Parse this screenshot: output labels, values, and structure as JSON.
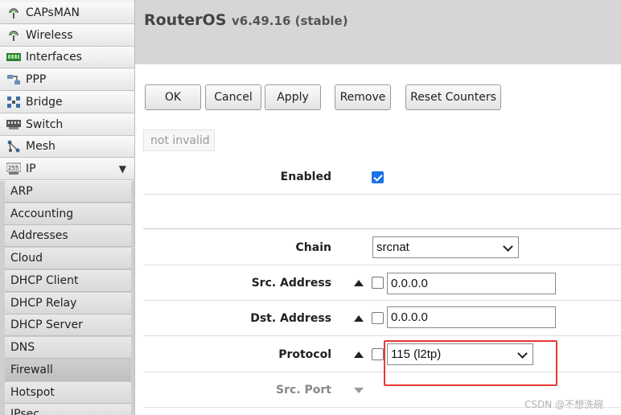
{
  "sidebar": {
    "items": [
      {
        "label": "CAPsMAN",
        "icon": "capsman-antenna-icon"
      },
      {
        "label": "Wireless",
        "icon": "wireless-antenna-icon"
      },
      {
        "label": "Interfaces",
        "icon": "interfaces-icon"
      },
      {
        "label": "PPP",
        "icon": "ppp-icon"
      },
      {
        "label": "Bridge",
        "icon": "bridge-icon"
      },
      {
        "label": "Switch",
        "icon": "switch-icon"
      },
      {
        "label": "Mesh",
        "icon": "mesh-icon"
      },
      {
        "label": "IP",
        "icon": "ip-icon",
        "expand_glyph": "▼"
      }
    ],
    "sub_items": [
      {
        "label": "ARP"
      },
      {
        "label": "Accounting"
      },
      {
        "label": "Addresses"
      },
      {
        "label": "Cloud"
      },
      {
        "label": "DHCP Client"
      },
      {
        "label": "DHCP Relay"
      },
      {
        "label": "DHCP Server"
      },
      {
        "label": "DNS"
      },
      {
        "label": "Firewall",
        "active": true
      },
      {
        "label": "Hotspot"
      },
      {
        "label": "IPsec"
      }
    ]
  },
  "header": {
    "product": "RouterOS",
    "version": "v6.49.16 (stable)"
  },
  "toolbar": {
    "ok": "OK",
    "cancel": "Cancel",
    "apply": "Apply",
    "remove": "Remove",
    "reset_counters": "Reset Counters"
  },
  "status_tag": "not invalid",
  "form": {
    "enabled": {
      "label": "Enabled",
      "checked": true
    },
    "chain": {
      "label": "Chain",
      "value": "srcnat"
    },
    "src_address": {
      "label": "Src. Address",
      "value": "0.0.0.0"
    },
    "dst_address": {
      "label": "Dst. Address",
      "value": "0.0.0.0"
    },
    "protocol": {
      "label": "Protocol",
      "value": "115 (l2tp)"
    },
    "src_port": {
      "label": "Src. Port"
    }
  },
  "watermark": "CSDN @不想洗碗",
  "colors": {
    "highlight": "#e53935",
    "checkbox": "#1a73e8"
  }
}
